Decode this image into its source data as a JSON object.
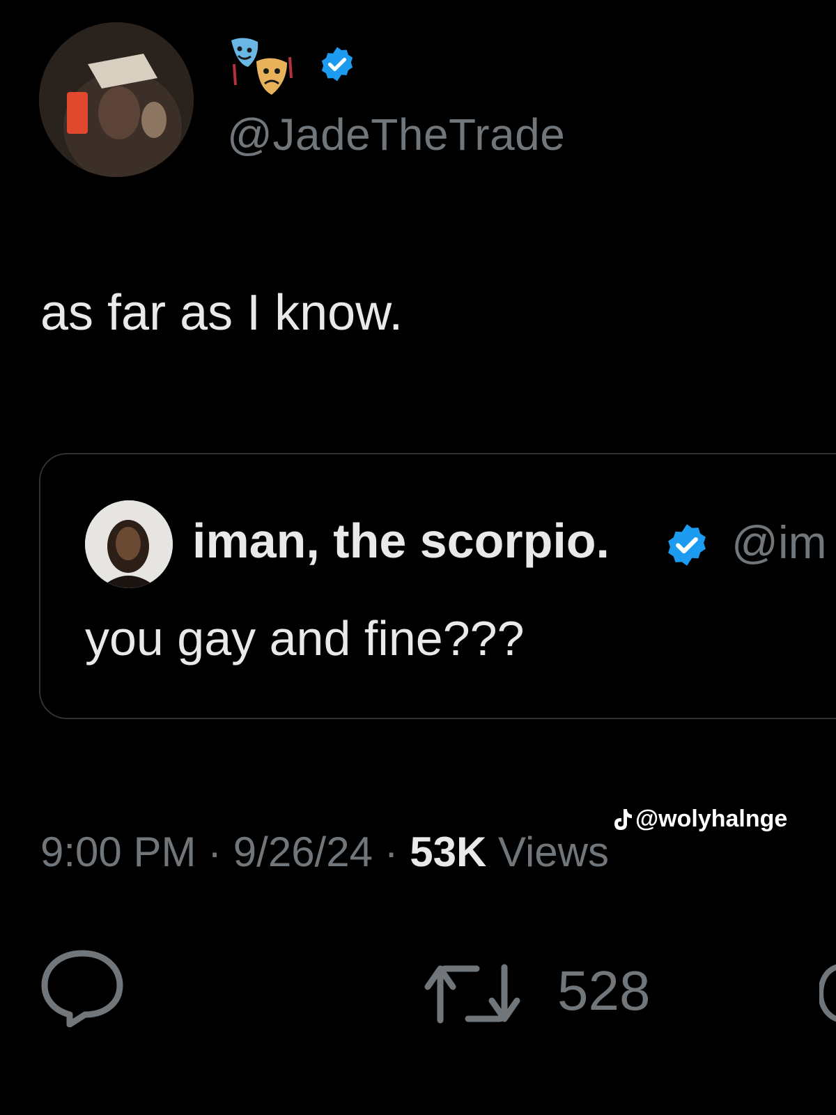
{
  "author": {
    "handle": "@JadeTheTrade",
    "badge_emoji": "🎭",
    "verified_color": "#1d9bf0"
  },
  "tweet": {
    "text": "as far as I know."
  },
  "quoted_tweet": {
    "name": "iman, the scorpio.",
    "handle_partial": "@im",
    "text": "you gay and fine???"
  },
  "meta": {
    "time": "9:00 PM",
    "separator": " · ",
    "date": "9/26/24",
    "views_count": "53K",
    "views_label": " Views"
  },
  "actions": {
    "retweet_count": "528",
    "reply_icon": "reply-icon",
    "retweet_icon": "retweet-icon"
  },
  "watermark": {
    "text": "@wolyhalnge",
    "icon": "tiktok-icon"
  }
}
